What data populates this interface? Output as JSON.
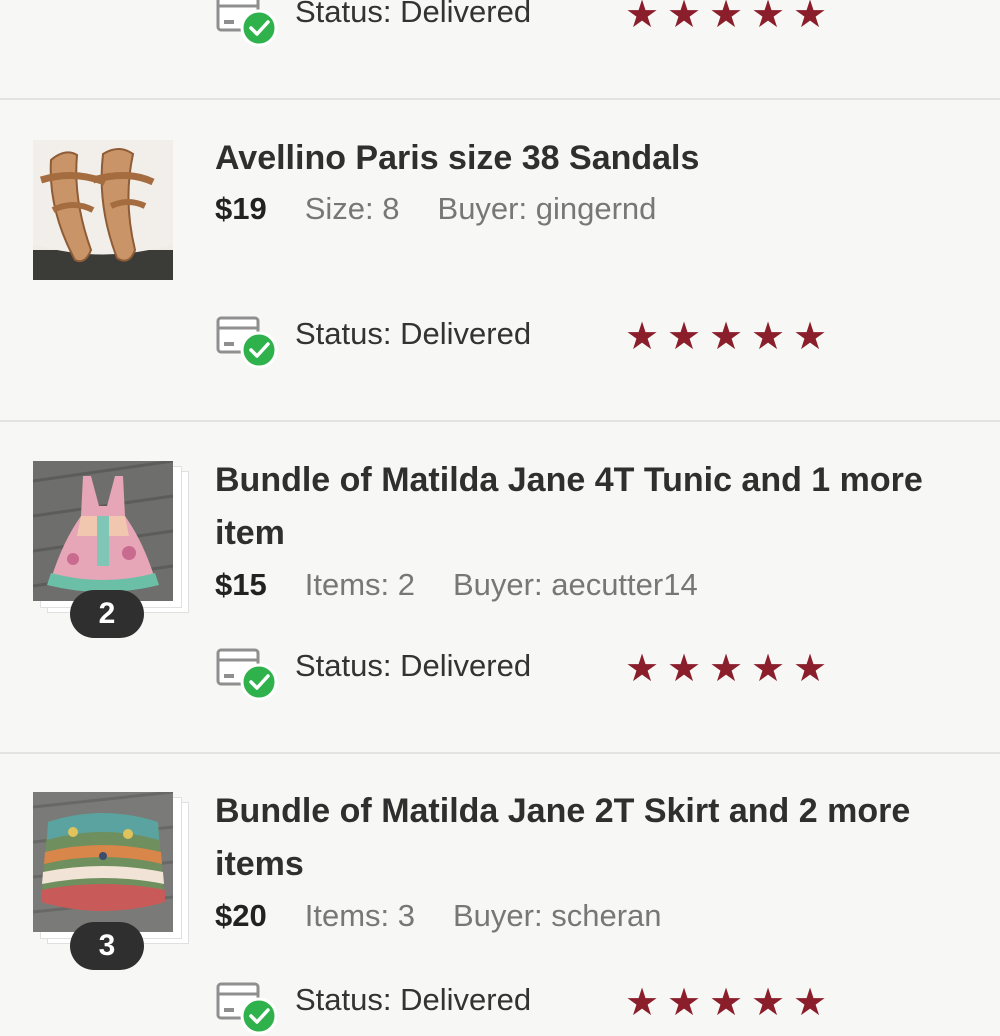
{
  "sold_items": [
    {
      "title": "",
      "price": "",
      "attr": "",
      "buyer": "",
      "status_label": "Status:",
      "status_value": "Delivered",
      "rating": 5
    },
    {
      "title": "Avellino Paris size 38 Sandals",
      "price": "$19",
      "attr": "Size: 8",
      "buyer": "Buyer: gingernd",
      "status_label": "Status:",
      "status_value": "Delivered",
      "rating": 5
    },
    {
      "title": "Bundle of Matilda Jane 4T Tunic and 1 more item",
      "price": "$15",
      "attr": "Items: 2",
      "buyer": "Buyer: aecutter14",
      "bundle_count": "2",
      "status_label": "Status:",
      "status_value": "Delivered",
      "rating": 5
    },
    {
      "title": "Bundle of Matilda Jane 2T Skirt and 2 more items",
      "price": "$20",
      "attr": "Items: 3",
      "buyer": "Buyer: scheran",
      "bundle_count": "3",
      "status_label": "Status:",
      "status_value": "Delivered",
      "rating": 5
    }
  ],
  "colors": {
    "star": "#8b1e2b",
    "check": "#2fb24c",
    "badge": "#2f2f2f"
  },
  "icons": {
    "status": "package-delivered-icon",
    "rating": "star-icon"
  }
}
